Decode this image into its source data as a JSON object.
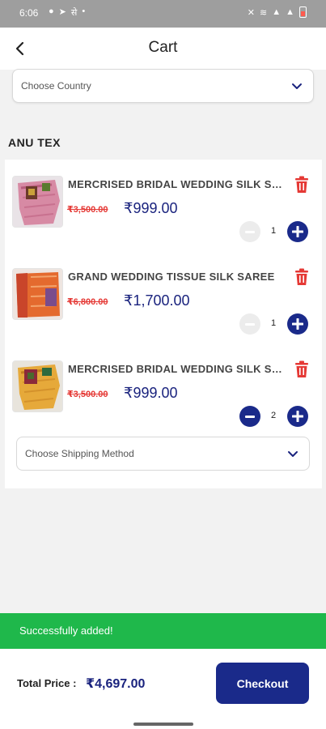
{
  "status_bar": {
    "time": "6:06",
    "left_icons": [
      "chat-bubble-icon",
      "telegram-icon",
      "app-glyph",
      "dot-icon"
    ],
    "left_glyphs": [
      "●",
      "➤",
      "से",
      "•"
    ],
    "right_icons": [
      "mute-icon",
      "wifi-icon",
      "signal-icon",
      "signal-icon",
      "battery-icon"
    ],
    "right_glyphs": [
      "✕",
      "≋",
      "▲",
      "▲"
    ]
  },
  "header": {
    "title": "Cart"
  },
  "country_select": {
    "placeholder": "Choose Country"
  },
  "store": {
    "name": "ANU TEX"
  },
  "items": [
    {
      "title": "MERCRISED BRIDAL WEDDING SILK SAREE",
      "old_price": "₹3,500.00",
      "new_price": "₹999.00",
      "quantity": "1",
      "minus_enabled": false
    },
    {
      "title": "GRAND WEDDING TISSUE SILK SAREE",
      "old_price": "₹6,800.00",
      "new_price": "₹1,700.00",
      "quantity": "1",
      "minus_enabled": false
    },
    {
      "title": "MERCRISED BRIDAL WEDDING SILK SAREE",
      "old_price": "₹3,500.00",
      "new_price": "₹999.00",
      "quantity": "2",
      "minus_enabled": true
    }
  ],
  "shipping_select": {
    "placeholder": "Choose Shipping Method"
  },
  "toast": {
    "message": "Successfully added!"
  },
  "footer": {
    "total_label": "Total Price :",
    "total_value": "₹4,697.00",
    "checkout_label": "Checkout"
  },
  "colors": {
    "primary": "#1a2a8a",
    "price_blue": "#1a237e",
    "strike_red": "#e53935",
    "toast_green": "#1fb84b",
    "trash_red": "#e53935"
  }
}
